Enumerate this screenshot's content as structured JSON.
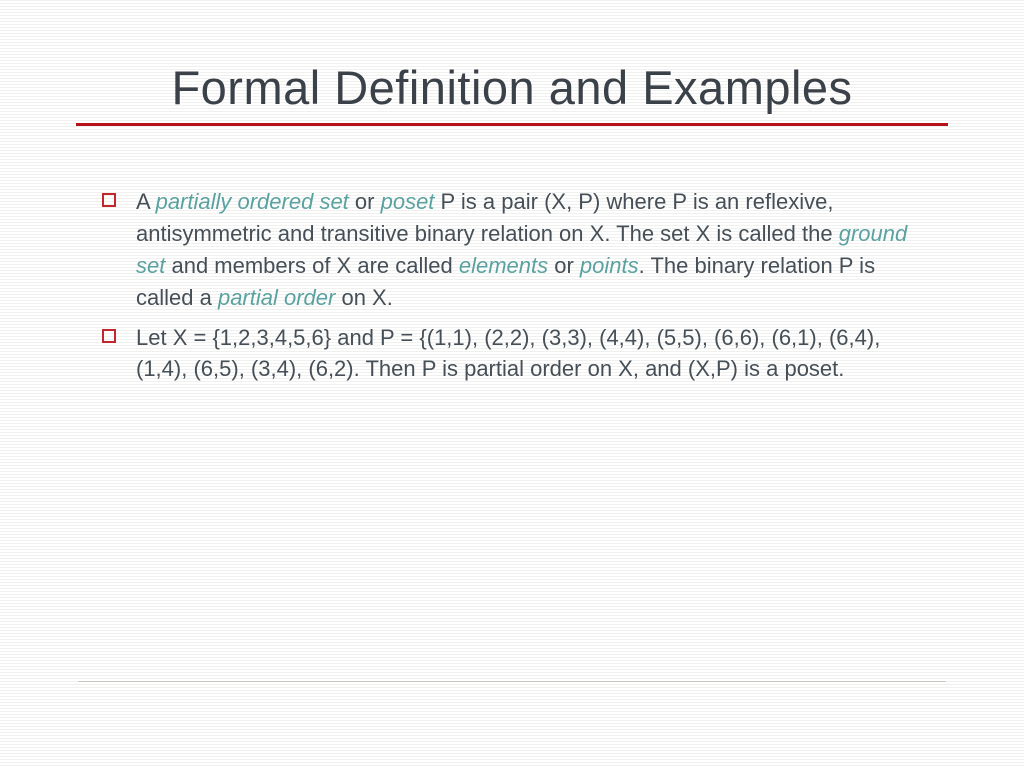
{
  "title": "Formal Definition and Examples",
  "bullets": [
    {
      "segments": [
        {
          "text": "A "
        },
        {
          "text": "partially ordered set",
          "term": true
        },
        {
          "text": " or "
        },
        {
          "text": "poset",
          "term": true
        },
        {
          "text": "  P  is a pair  (X, P)  where  P is an reflexive, antisymmetric and transitive binary relation on  X.  The set  X  is called the "
        },
        {
          "text": "ground set",
          "term": true
        },
        {
          "text": " and members of X  are called "
        },
        {
          "text": "elements",
          "term": true
        },
        {
          "text": " or "
        },
        {
          "text": "points",
          "term": true
        },
        {
          "text": ".  The binary relation  P  is called a "
        },
        {
          "text": "partial order",
          "term": true
        },
        {
          "text": " on  X."
        }
      ]
    },
    {
      "segments": [
        {
          "text": "Let  X = {1,2,3,4,5,6} and P = {(1,1), (2,2), (3,3), (4,4), (5,5), (6,6), (6,1), (6,4), (1,4), (6,5), (3,4), (6,2).  Then  P  is partial order on  X, and  (X,P)  is a poset."
        }
      ]
    }
  ]
}
